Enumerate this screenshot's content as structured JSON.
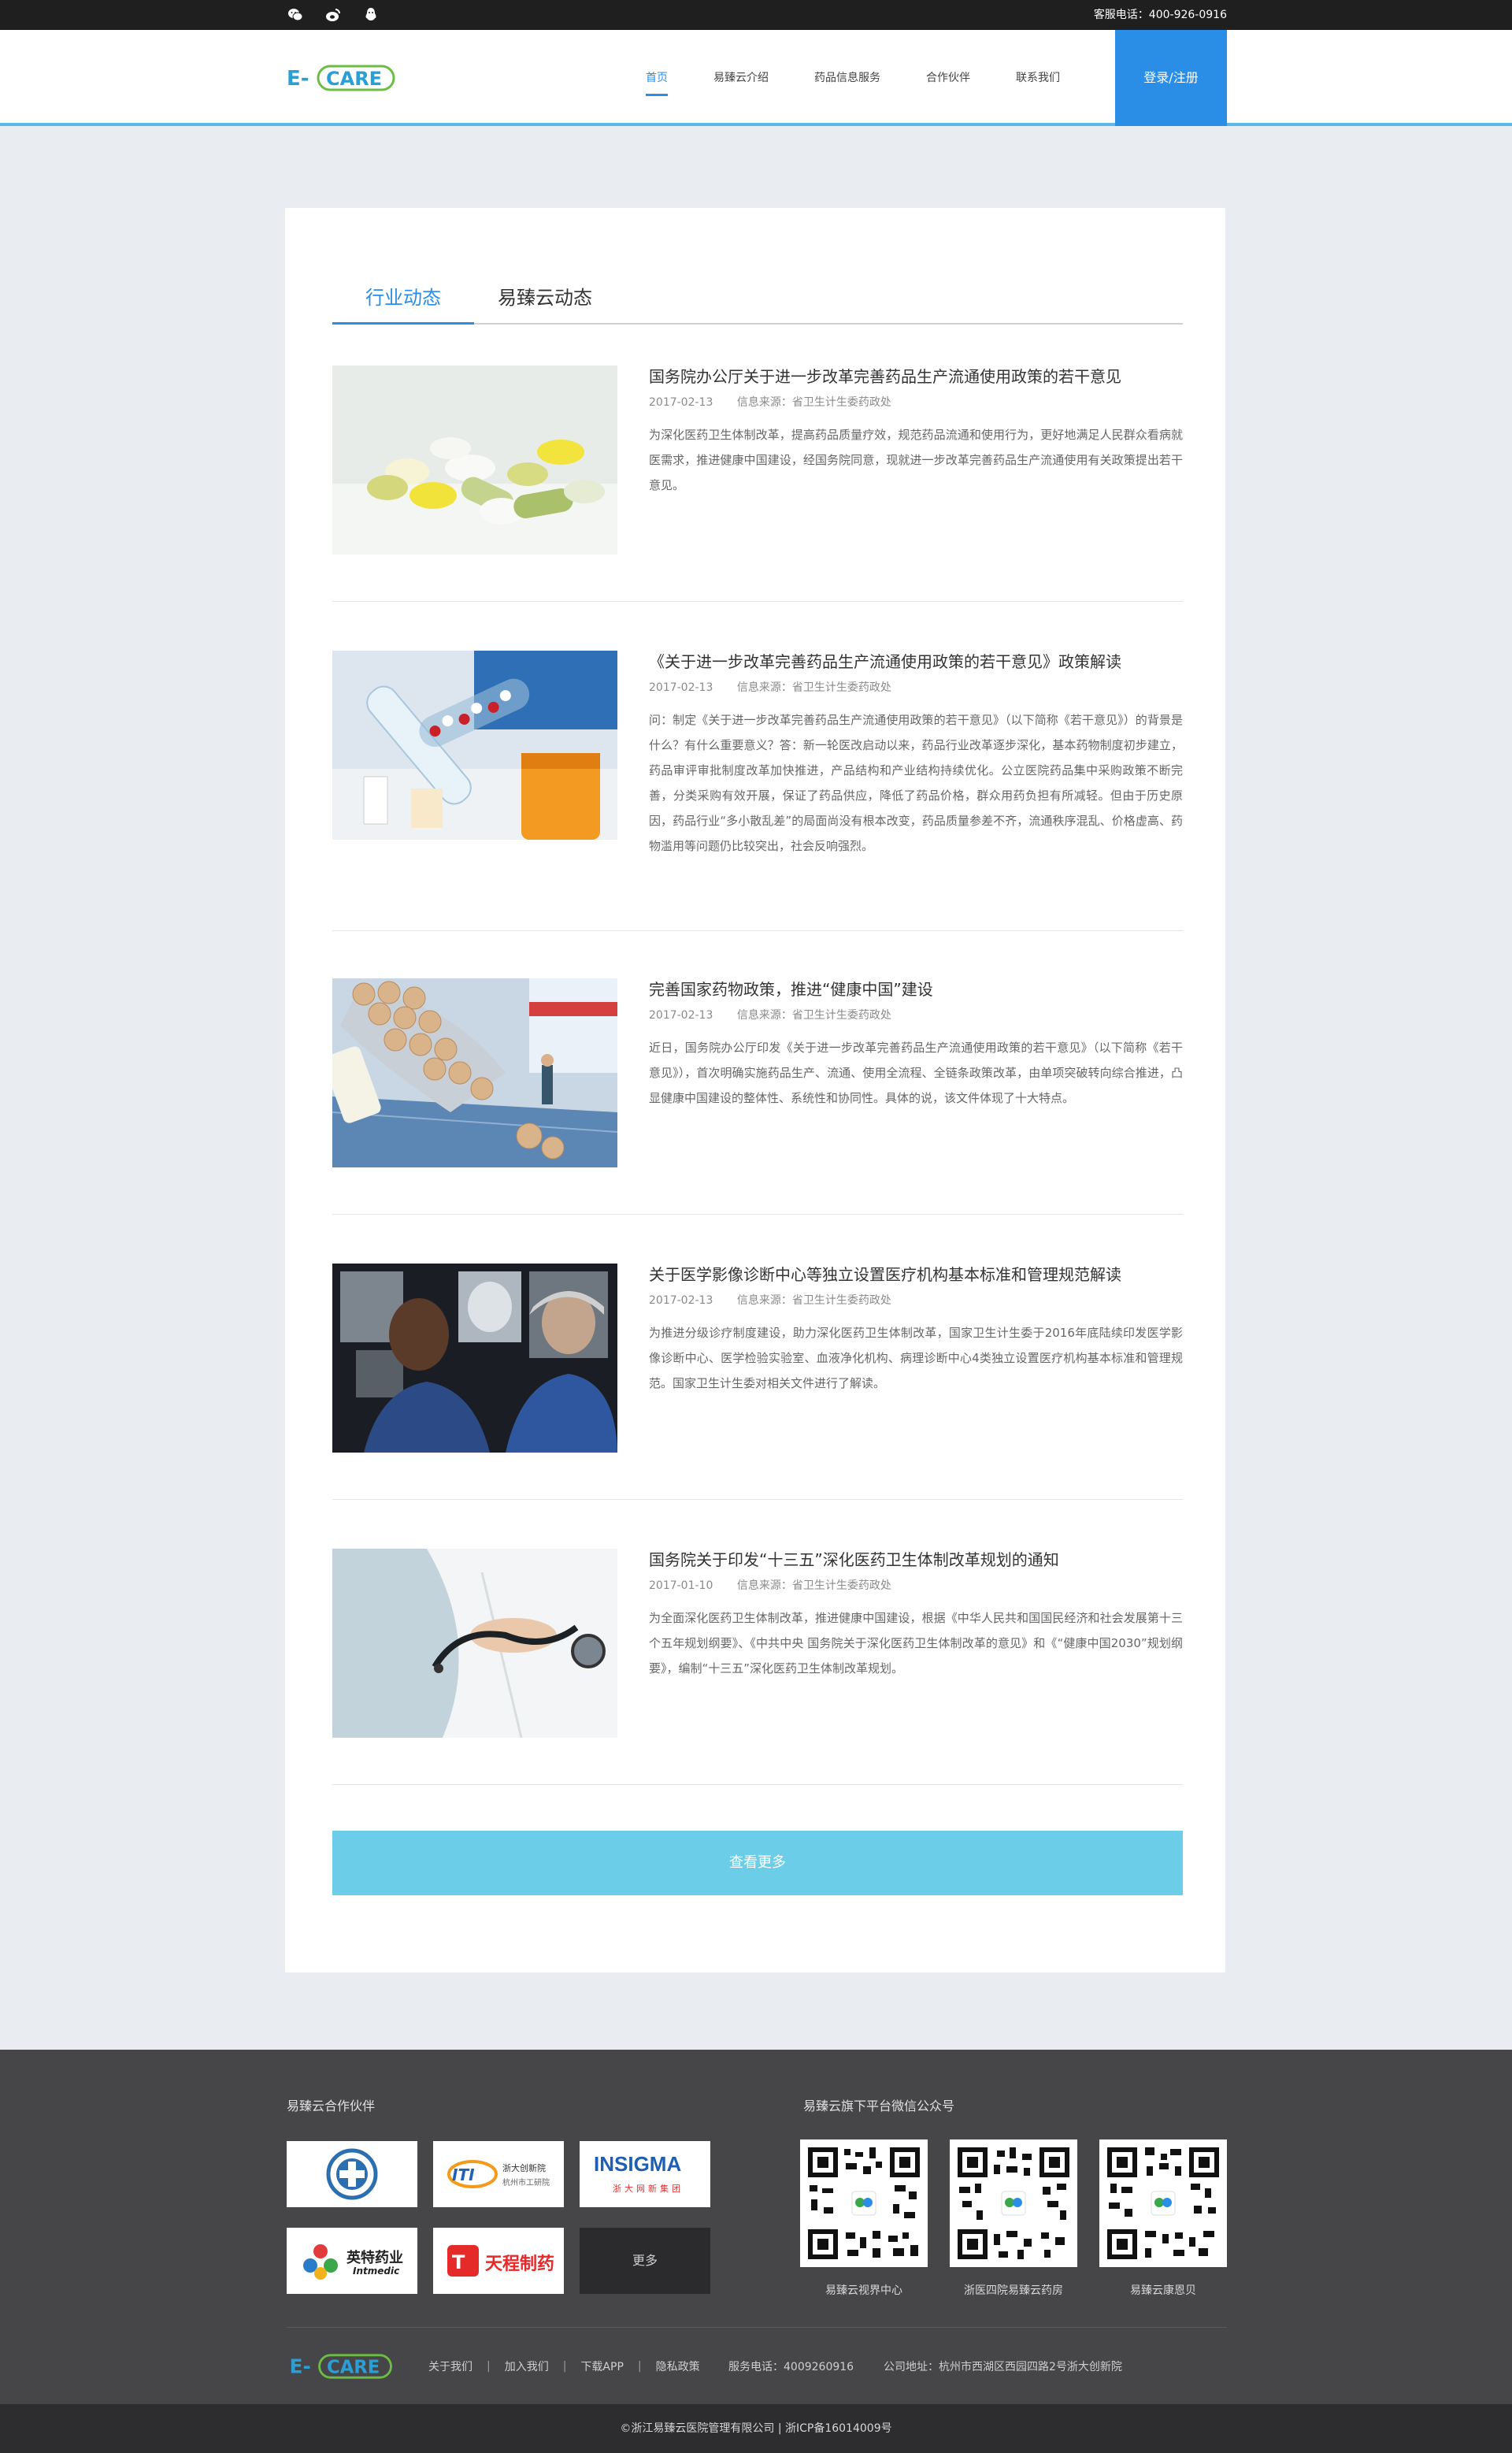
{
  "topbar": {
    "icons": [
      "wechat-icon",
      "weibo-icon",
      "qq-icon"
    ],
    "phone": "客服电话：400-926-0916"
  },
  "header": {
    "logo_text": "E-CARE",
    "nav": [
      {
        "label": "首页",
        "active": true
      },
      {
        "label": "易臻云介绍",
        "active": false
      },
      {
        "label": "药品信息服务",
        "active": false
      },
      {
        "label": "合作伙伴",
        "active": false
      },
      {
        "label": "联系我们",
        "active": false
      }
    ],
    "login_label": "登录/注册"
  },
  "tabs": [
    "行业动态",
    "易臻云动态"
  ],
  "articles": [
    {
      "title": "国务院办公厅关于进一步改革完善药品生产流通使用政策的若干意见",
      "date": "2017-02-13",
      "source": "信息来源：省卫生计生委药政处",
      "summary": "为深化医药卫生体制改革，提高药品质量疗效，规范药品流通和使用行为，更好地满足人民群众看病就医需求，推进健康中国建设，经国务院同意，现就进一步改革完善药品生产流通使用有关政策提出若干意见。"
    },
    {
      "title": "《关于进一步改革完善药品生产流通使用政策的若干意见》政策解读",
      "date": "2017-02-13",
      "source": "信息来源：省卫生计生委药政处",
      "summary": "问：制定《关于进一步改革完善药品生产流通使用政策的若干意见》（以下简称《若干意见》）的背景是什么？有什么重要意义？答：新一轮医改启动以来，药品行业改革逐步深化，基本药物制度初步建立，药品审评审批制度改革加快推进，产品结构和产业结构持续优化。公立医院药品集中采购政策不断完善，分类采购有效开展，保证了药品供应，降低了药品价格，群众用药负担有所减轻。但由于历史原因，药品行业“多小散乱差”的局面尚没有根本改变，药品质量参差不齐，流通秩序混乱、价格虚高、药物滥用等问题仍比较突出，社会反响强烈。"
    },
    {
      "title": "完善国家药物政策，推进“健康中国”建设",
      "date": "2017-02-13",
      "source": "信息来源：省卫生计生委药政处",
      "summary": "近日，国务院办公厅印发《关于进一步改革完善药品生产流通使用政策的若干意见》（以下简称《若干意见》），首次明确实施药品生产、流通、使用全流程、全链条政策改革，由单项突破转向综合推进，凸显健康中国建设的整体性、系统性和协同性。具体的说，该文件体现了十大特点。"
    },
    {
      "title": "关于医学影像诊断中心等独立设置医疗机构基本标准和管理规范解读",
      "date": "2017-02-13",
      "source": "信息来源：省卫生计生委药政处",
      "summary": "为推进分级诊疗制度建设，助力深化医药卫生体制改革，国家卫生计生委于2016年底陆续印发医学影像诊断中心、医学检验实验室、血液净化机构、病理诊断中心4类独立设置医疗机构基本标准和管理规范。国家卫生计生委对相关文件进行了解读。"
    },
    {
      "title": "国务院关于印发“十三五”深化医药卫生体制改革规划的通知",
      "date": "2017-01-10",
      "source": "信息来源：省卫生计生委药政处",
      "summary": "为全面深化医药卫生体制改革，推进健康中国建设，根据《中华人民共和国国民经济和社会发展第十三个五年规划纲要》、《中共中央 国务院关于深化医药卫生体制改革的意见》和《“健康中国2030”规划纲要》，编制“十三五”深化医药卫生体制改革规划。"
    }
  ],
  "more_label": "查看更多",
  "footer": {
    "partners_title": "易臻云合作伙伴",
    "partners": [
      {
        "name": "",
        "type": "seal"
      },
      {
        "name": "浙大创新院",
        "sub": "杭州市工研院",
        "type": "itizju"
      },
      {
        "name": "INSIGMA",
        "sub": "浙大网新集团",
        "type": "insigma"
      },
      {
        "name": "英特药业",
        "sub": "Intmedic",
        "type": "intmedic"
      },
      {
        "name": "天程制药",
        "type": "tiancheng"
      }
    ],
    "partners_more": "更多",
    "wechat_title": "易臻云旗下平台微信公众号",
    "qrcodes": [
      "易臻云视界中心",
      "浙医四院易臻云药房",
      "易臻云康恩贝"
    ],
    "links": [
      "关于我们",
      "加入我们",
      "下载APP",
      "隐私政策"
    ],
    "phone": "服务电话：4009260916",
    "address": "公司地址：杭州市西湖区西园四路2号浙大创新院",
    "copyright": "©浙江易臻云医院管理有限公司 | 浙ICP备16014009号"
  },
  "colors": {
    "accent": "#2a8ee6",
    "header_line": "#5db8ea",
    "more_button": "#6ccde8",
    "footer_bg": "#464649",
    "topbar_bg": "#1f1f1f"
  }
}
